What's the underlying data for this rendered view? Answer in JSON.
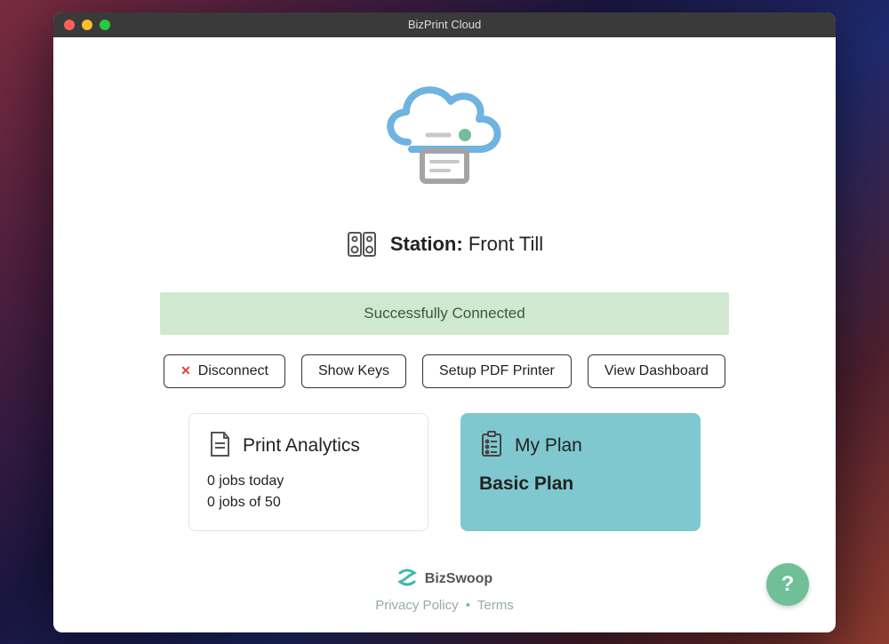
{
  "window": {
    "title": "BizPrint Cloud"
  },
  "station": {
    "label": "Station:",
    "name": "Front Till"
  },
  "banner": {
    "message": "Successfully Connected"
  },
  "buttons": {
    "disconnect": "Disconnect",
    "show_keys": "Show Keys",
    "setup_pdf": "Setup PDF Printer",
    "view_dashboard": "View Dashboard"
  },
  "analytics": {
    "title": "Print Analytics",
    "line1": "0 jobs today",
    "line2": "0 jobs of 50",
    "jobs_today": 0,
    "jobs_used": 0,
    "jobs_limit": 50
  },
  "plan": {
    "title": "My Plan",
    "name": "Basic Plan"
  },
  "footer": {
    "brand": "BizSwoop",
    "privacy": "Privacy Policy",
    "terms": "Terms"
  },
  "help": {
    "label": "?"
  }
}
